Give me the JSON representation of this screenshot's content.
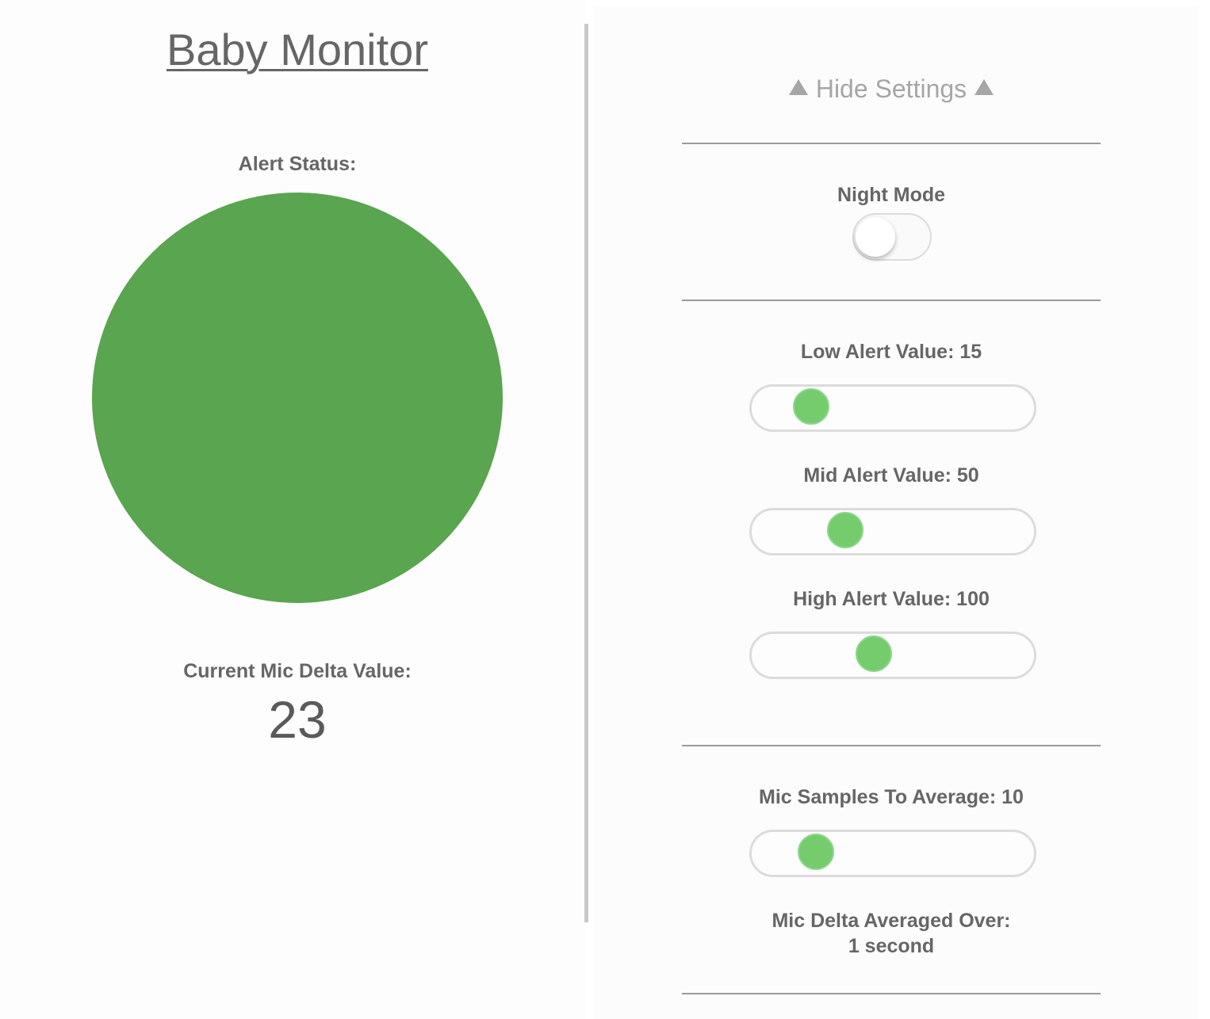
{
  "title": "Baby Monitor",
  "alert": {
    "label": "Alert Status:",
    "color": "#5aa54f"
  },
  "mic": {
    "label": "Current Mic Delta Value:",
    "value": "23"
  },
  "settings": {
    "toggle_label": "Hide Settings",
    "night_mode": {
      "label": "Night Mode",
      "enabled": false
    },
    "sliders": [
      {
        "label": "Low Alert Value: 15",
        "value": 15,
        "fill_fraction": 0.16
      },
      {
        "label": "Mid Alert Value: 50",
        "value": 50,
        "fill_fraction": 0.3
      },
      {
        "label": "High Alert Value: 100",
        "value": 100,
        "fill_fraction": 0.42
      },
      {
        "label": "Mic Samples To Average: 10",
        "value": 10,
        "fill_fraction": 0.18
      }
    ],
    "averaged_over": {
      "label": "Mic Delta Averaged Over:",
      "value": "1 second"
    },
    "thumb_color": "#74cc6c"
  }
}
